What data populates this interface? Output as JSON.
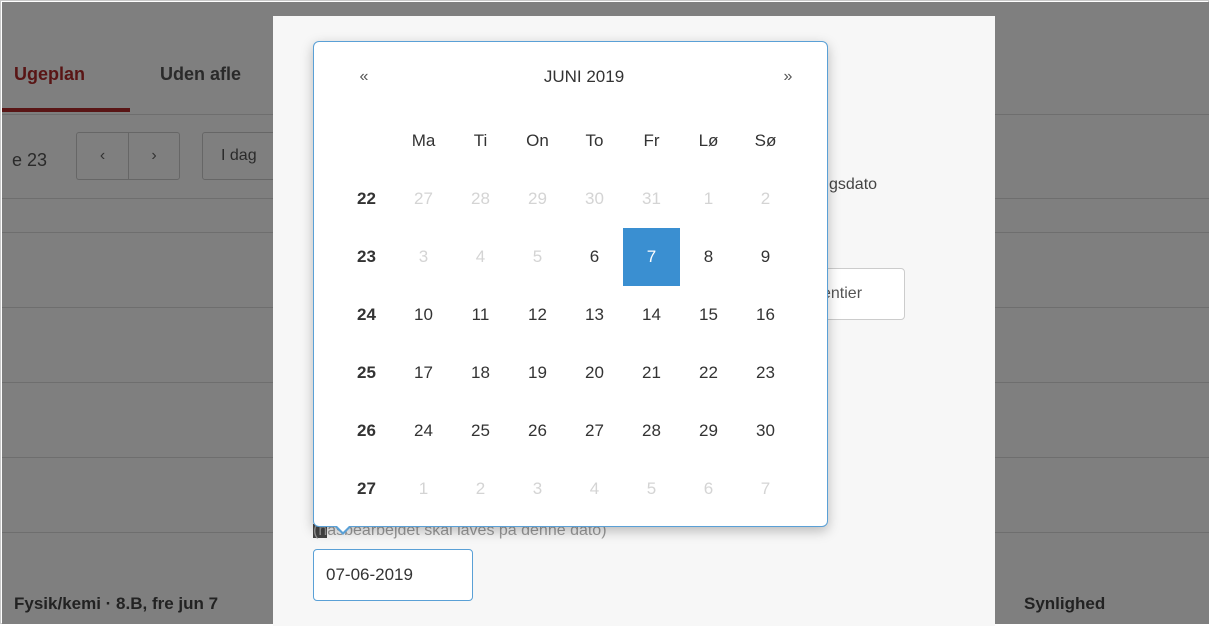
{
  "background": {
    "tab_active": "Ugeplan",
    "tab_second": "Uden afle",
    "week_label": "e 23",
    "prev_glyph": "‹",
    "next_glyph": "›",
    "today_button": "I dag",
    "bottom_left_text": "Fysik/kemi · 8.B, fre jun 7",
    "bottom_right_text": "Synlighed"
  },
  "modal": {
    "deadline_label": "gsdato",
    "more_options_button": "entier",
    "note_text": "(hasbearbejdet skal laves på denne dato)",
    "date_input_value": "07-06-2019"
  },
  "calendar": {
    "prev_glyph": "«",
    "title": "JUNI 2019",
    "next_glyph": "»",
    "weekdays": [
      "Ma",
      "Ti",
      "On",
      "To",
      "Fr",
      "Lø",
      "Sø"
    ],
    "weeks": [
      {
        "week": "22",
        "days": [
          [
            "27",
            true
          ],
          [
            "28",
            true
          ],
          [
            "29",
            true
          ],
          [
            "30",
            true
          ],
          [
            "31",
            true
          ],
          [
            "1",
            true
          ],
          [
            "2",
            true
          ]
        ]
      },
      {
        "week": "23",
        "days": [
          [
            "3",
            true
          ],
          [
            "4",
            true
          ],
          [
            "5",
            true
          ],
          [
            "6",
            false
          ],
          [
            "7",
            false
          ],
          [
            "8",
            false
          ],
          [
            "9",
            false
          ]
        ]
      },
      {
        "week": "24",
        "days": [
          [
            "10",
            false
          ],
          [
            "11",
            false
          ],
          [
            "12",
            false
          ],
          [
            "13",
            false
          ],
          [
            "14",
            false
          ],
          [
            "15",
            false
          ],
          [
            "16",
            false
          ]
        ]
      },
      {
        "week": "25",
        "days": [
          [
            "17",
            false
          ],
          [
            "18",
            false
          ],
          [
            "19",
            false
          ],
          [
            "20",
            false
          ],
          [
            "21",
            false
          ],
          [
            "22",
            false
          ],
          [
            "23",
            false
          ]
        ]
      },
      {
        "week": "26",
        "days": [
          [
            "24",
            false
          ],
          [
            "25",
            false
          ],
          [
            "26",
            false
          ],
          [
            "27",
            false
          ],
          [
            "28",
            false
          ],
          [
            "29",
            false
          ],
          [
            "30",
            false
          ]
        ]
      },
      {
        "week": "27",
        "days": [
          [
            "1",
            true
          ],
          [
            "2",
            true
          ],
          [
            "3",
            true
          ],
          [
            "4",
            true
          ],
          [
            "5",
            true
          ],
          [
            "6",
            true
          ],
          [
            "7",
            true
          ]
        ]
      }
    ],
    "selected_day": "7",
    "selected_week": "23",
    "selected_color": "#3a8fd1"
  }
}
